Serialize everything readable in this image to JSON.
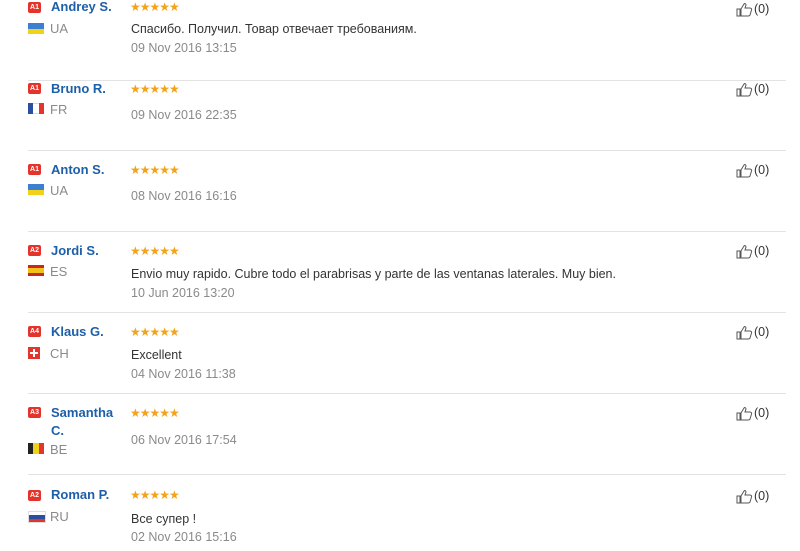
{
  "reviews": [
    {
      "badge": "A1",
      "name": "Andrey S.",
      "country": "UA",
      "flag": "ua",
      "stars": "★★★★★",
      "text": "Спасибо. Получил. Товар отвечает требованиям.",
      "date": "09 Nov 2016 13:15",
      "likes": "(0)"
    },
    {
      "badge": "A1",
      "name": "Bruno R.",
      "country": "FR",
      "flag": "fr",
      "stars": "★★★★★",
      "text": "",
      "date": "09 Nov 2016 22:35",
      "likes": "(0)"
    },
    {
      "badge": "A1",
      "name": "Anton S.",
      "country": "UA",
      "flag": "ua",
      "stars": "★★★★★",
      "text": "",
      "date": "08 Nov 2016 16:16",
      "likes": "(0)"
    },
    {
      "badge": "A2",
      "name": "Jordi S.",
      "country": "ES",
      "flag": "es",
      "stars": "★★★★★",
      "text": "Envio muy rapido. Cubre todo el parabrisas y parte de las ventanas laterales. Muy bien.",
      "date": "10 Jun 2016 13:20",
      "likes": "(0)"
    },
    {
      "badge": "A4",
      "name": "Klaus G.",
      "country": "CH",
      "flag": "ch",
      "stars": "★★★★★",
      "text": "Excellent",
      "date": "04 Nov 2016 11:38",
      "likes": "(0)"
    },
    {
      "badge": "A3",
      "name": "Samantha C.",
      "country": "BE",
      "flag": "be",
      "stars": "★★★★★",
      "text": "",
      "date": "06 Nov 2016 17:54",
      "likes": "(0)"
    },
    {
      "badge": "A2",
      "name": "Roman P.",
      "country": "RU",
      "flag": "ru",
      "stars": "★★★★★",
      "text": "Все супер !",
      "date": "02 Nov 2016 15:16",
      "likes": "(0)"
    }
  ]
}
